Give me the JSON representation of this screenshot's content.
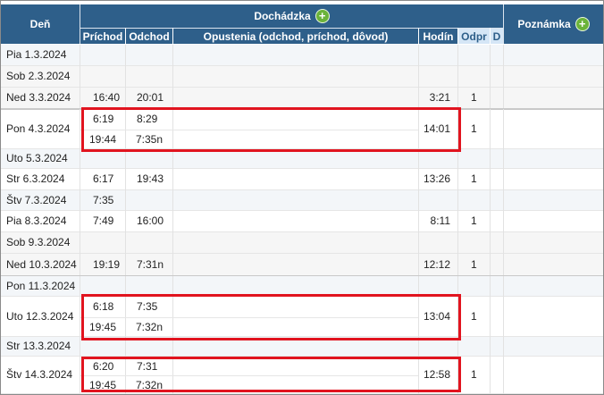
{
  "header": {
    "den": "Deň",
    "dochadzka": "Dochádzka",
    "poznamka": "Poznámka",
    "prichod": "Príchod",
    "odchod": "Odchod",
    "opustenia": "Opustenia (odchod, príchod, dôvod)",
    "hodin": "Hodín",
    "odpr": "Odpr",
    "d": "D",
    "add_icon": "plus-icon",
    "accent_color": "#2e5f8a",
    "add_color": "#6bb33a",
    "highlight_color": "#e1141f"
  },
  "rows": [
    {
      "day": "Pia 1.3.2024"
    },
    {
      "day": "Sob 2.3.2024"
    },
    {
      "day": "Ned 3.3.2024",
      "prichod": "16:40",
      "odchod": "20:01",
      "hodin": "3:21",
      "odpr": "1"
    },
    {
      "day": "Pon 4.3.2024",
      "prichod": "6:19",
      "odchod": "8:29",
      "prichod2": "19:44",
      "odchod2": "7:35n",
      "hodin": "14:01",
      "odpr": "1"
    },
    {
      "day": "Uto 5.3.2024"
    },
    {
      "day": "Str 6.3.2024",
      "prichod": "6:17",
      "odchod": "19:43",
      "hodin": "13:26",
      "odpr": "1"
    },
    {
      "day": "Štv 7.3.2024",
      "prichod": "7:35"
    },
    {
      "day": "Pia 8.3.2024",
      "prichod": "7:49",
      "odchod": "16:00",
      "hodin": "8:11",
      "odpr": "1"
    },
    {
      "day": "Sob 9.3.2024"
    },
    {
      "day": "Ned 10.3.2024",
      "prichod": "19:19",
      "odchod": "7:31n",
      "hodin": "12:12",
      "odpr": "1"
    },
    {
      "day": "Pon 11.3.2024"
    },
    {
      "day": "Uto 12.3.2024",
      "prichod": "6:18",
      "odchod": "7:35",
      "prichod2": "19:45",
      "odchod2": "7:32n",
      "hodin": "13:04",
      "odpr": "1"
    },
    {
      "day": "Str 13.3.2024"
    },
    {
      "day": "Štv 14.3.2024",
      "prichod": "6:20",
      "odchod": "7:31",
      "prichod2": "19:45",
      "odchod2": "7:32n",
      "hodin": "12:58",
      "odpr": "1"
    }
  ]
}
